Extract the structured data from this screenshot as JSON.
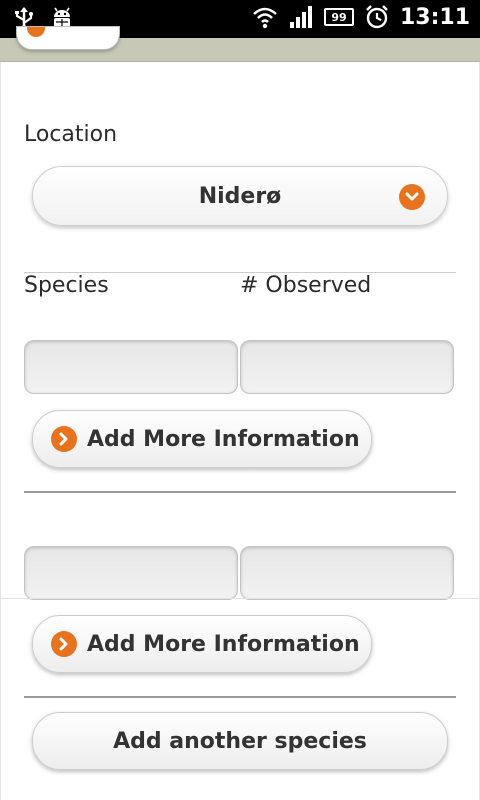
{
  "status_bar": {
    "time": "13:11",
    "battery": "99",
    "icons": [
      "usb-icon",
      "android-debug-icon",
      "wifi-icon",
      "signal-icon",
      "battery-icon",
      "alarm-icon"
    ]
  },
  "form": {
    "location_label": "Location",
    "location_value": "Niderø",
    "species_label": "Species",
    "observed_label": "# Observed",
    "entries": [
      {
        "species_value": "",
        "count_value": "",
        "more_label": "Add More Information"
      },
      {
        "species_value": "",
        "count_value": "",
        "more_label": "Add More Information"
      }
    ],
    "add_species_label": "Add another species"
  },
  "colors": {
    "accent": "#e8731f",
    "header_strip": "#c7c9b6"
  }
}
